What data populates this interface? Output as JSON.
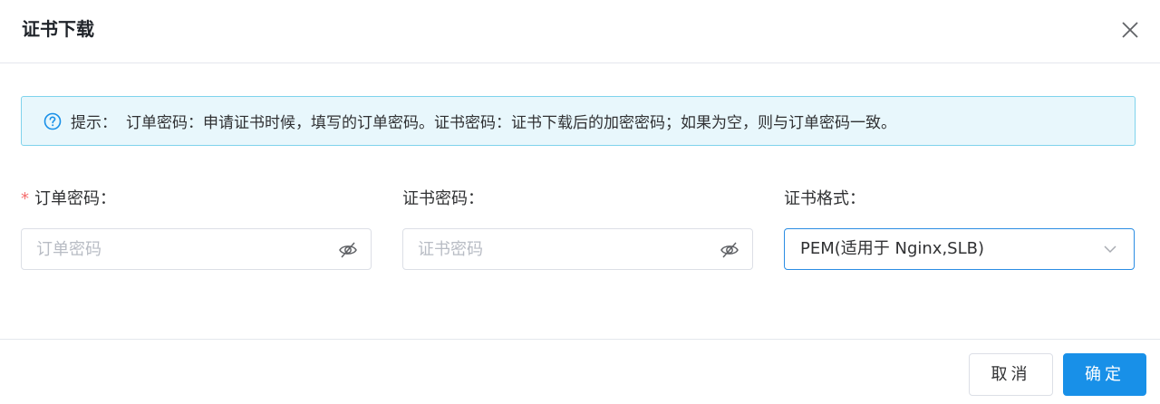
{
  "dialog": {
    "title": "证书下载",
    "close_icon": "close-icon"
  },
  "tip": {
    "icon": "question-circle-icon",
    "label": "提示：",
    "text": "订单密码：申请证书时候，填写的订单密码。证书密码：证书下载后的加密密码；如果为空，则与订单密码一致。"
  },
  "form": {
    "order_password": {
      "required_mark": "*",
      "label": "订单密码：",
      "placeholder": "订单密码",
      "value": "",
      "icon": "eye-off-icon"
    },
    "cert_password": {
      "label": "证书密码：",
      "placeholder": "证书密码",
      "value": "",
      "icon": "eye-off-icon"
    },
    "cert_format": {
      "label": "证书格式：",
      "selected": "PEM(适用于 Nginx,SLB)",
      "icon": "chevron-down-icon"
    }
  },
  "footer": {
    "cancel_label": "取消",
    "ok_label": "确定"
  },
  "colors": {
    "primary": "#1890e8",
    "tip_background": "#e8f7fc",
    "tip_border": "#7fd3ec",
    "required": "#f56c6c",
    "focus_border": "#2b8de3"
  }
}
